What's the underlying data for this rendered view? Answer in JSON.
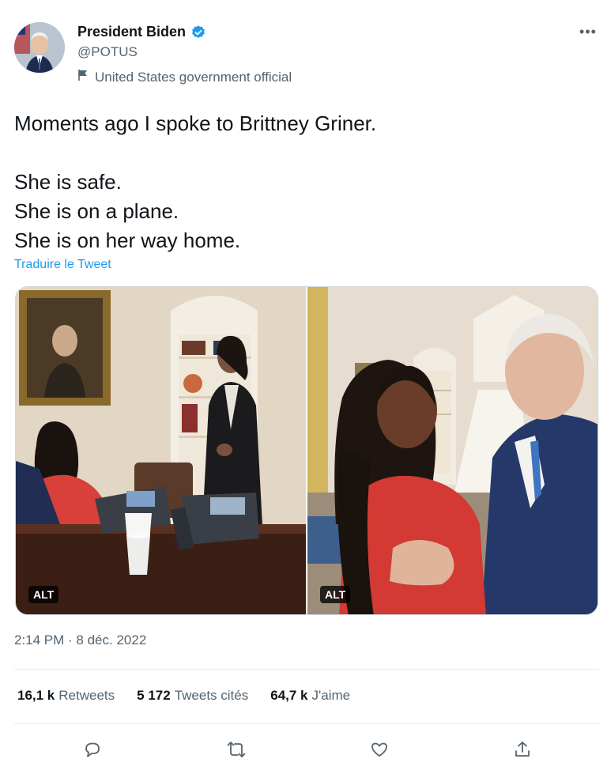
{
  "author": {
    "name": "President Biden",
    "handle": "@POTUS",
    "affiliation": "United States government official",
    "verified": true,
    "verified_color": "#1d9bf0"
  },
  "more_icon": "more-horizontal-icon",
  "tweet": {
    "lines": [
      "Moments ago I spoke to Brittney Griner.",
      "She is safe.",
      "She is on a plane.",
      "She is on her way home."
    ],
    "translate_label": "Traduire le Tweet"
  },
  "media": [
    {
      "alt_badge": "ALT"
    },
    {
      "alt_badge": "ALT"
    }
  ],
  "timestamp": "2:14 PM · 8 déc. 2022",
  "stats": [
    {
      "value": "16,1 k",
      "label": "Retweets"
    },
    {
      "value": "5 172",
      "label": "Tweets cités"
    },
    {
      "value": "64,7 k",
      "label": "J'aime"
    }
  ],
  "actions": [
    "reply-icon",
    "retweet-icon",
    "like-icon",
    "share-icon"
  ],
  "colors": {
    "link": "#1d9bf0",
    "secondary_text": "#536471",
    "primary_text": "#0f1419",
    "divider": "#e6ecf0"
  }
}
